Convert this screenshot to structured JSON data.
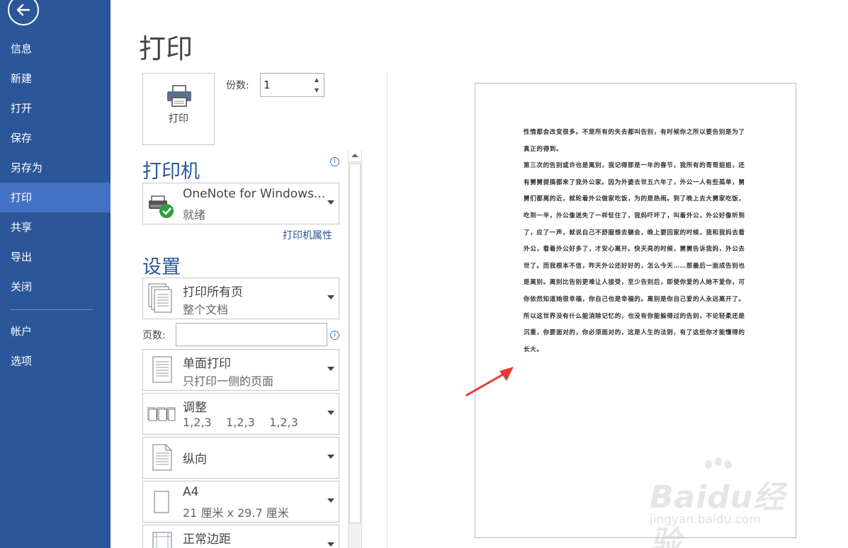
{
  "sidebar": {
    "items": [
      {
        "label": "信息"
      },
      {
        "label": "新建"
      },
      {
        "label": "打开"
      },
      {
        "label": "保存"
      },
      {
        "label": "另存为"
      },
      {
        "label": "打印",
        "active": true
      },
      {
        "label": "共享"
      },
      {
        "label": "导出"
      },
      {
        "label": "关闭"
      },
      {
        "label": "帐户"
      },
      {
        "label": "选项"
      }
    ]
  },
  "main": {
    "title": "打印",
    "print_button_label": "打印",
    "copies_label": "份数:",
    "copies_value": "1"
  },
  "printer": {
    "section_title": "打印机",
    "name": "OneNote for Windows...",
    "status": "就绪",
    "properties_link": "打印机属性"
  },
  "settings": {
    "section_title": "设置",
    "pages_label": "页数:",
    "pages_value": "",
    "items": [
      {
        "title": "打印所有页",
        "subtitle": "整个文档"
      },
      {
        "title": "单面打印",
        "subtitle": "只打印一侧的页面"
      },
      {
        "title": "调整",
        "subtitle": "1,2,3    1,2,3    1,2,3"
      },
      {
        "title": "纵向",
        "subtitle": ""
      },
      {
        "title": "A4",
        "subtitle": "21 厘米 x 29.7 厘米"
      },
      {
        "title": "正常边距",
        "subtitle": ""
      }
    ]
  },
  "preview": {
    "paragraphs": [
      "性情都会改变很多。不是所有的失去都叫告别，有时候你之所以要告别是为了真正的得到。",
      "第三次的告别或许也是离别，我记得那是一年的春节，我所有的哥哥姐姐，还有舅舅提搞都来了我外公家。因为外婆去世五六年了，外公一人有些孤单，舅舅们都离的近，就轮着外公做家吃饭，为的是热闹。到了晚上去大舅家吃饭，吃到一半，外公像迷失了一样怔住了，我妈吓坏了，叫着外公，外公好像听到了，应了一声，就说自己不舒服想去躺会，晚上要回家的时候，我和我妈去看外公，看着外公好多了，才安心离开。快天亮的时候，舅舅告诉我妈，外公去世了。而我根本不信，昨天外公还好好的，怎么今天……那最后一面成告别也是离别。离别比告别更难让人接受，至少告别后，即使你爱的人她不爱你，可你依然知道她很幸福，你自己也是幸福的。离别是你自己爱的人永远离开了。",
      "所以这世界没有什么能消除记忆的，也没有你能躲得过的告别，不论轻柔还是沉重，你要面对的，你必须面对的，这是人生的法则，有了这些你才能懂得的长大。"
    ]
  },
  "watermark": {
    "brand": "Baidu经验",
    "url": "jingyan.baidu.com"
  },
  "colors": {
    "sidebar_bg": "#2b579a",
    "sidebar_active": "#4472c4",
    "accent": "#2b579a",
    "annotation_arrow": "#e53935"
  }
}
